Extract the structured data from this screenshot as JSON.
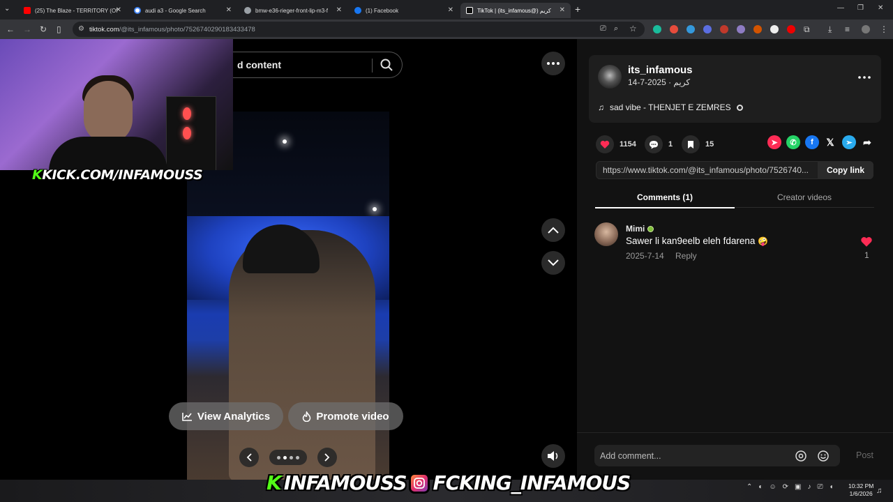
{
  "browser": {
    "tabs": [
      {
        "label": "(25) The Blaze - TERRITORY (Of",
        "color": "#ff0000"
      },
      {
        "label": "audi a3 - Google Search",
        "color": "#4285f4"
      },
      {
        "label": "bmw-e36-rieger-front-lip-m3-f",
        "color": "#9aa0a6"
      },
      {
        "label": "(1) Facebook",
        "color": "#1877f2"
      },
      {
        "label": "TikTok | (its_infamous@) كريم",
        "color": "#ffffff"
      }
    ],
    "new_tab": "+",
    "url_host": "tiktok.com",
    "url_path": "/@its_infamous/photo/7526740290183433478"
  },
  "stream": {
    "kick_channel": "KICK.COM/INFAMOUSS",
    "kick_k": "K",
    "overlay_kick": "INFAMOUSS",
    "overlay_instagram": "FCKING_INFAMOUS"
  },
  "viewer": {
    "search_text": "d content",
    "view_analytics": "View Analytics",
    "promote_video": "Promote video"
  },
  "post": {
    "username": "its_infamous",
    "display_name": "كريم",
    "date": "2025-7-14",
    "music": "sad vibe - THENJET E ZEMRES",
    "likes": "1154",
    "comments": "1",
    "saves": "15",
    "link": "https://www.tiktok.com/@its_infamous/photo/7526740...",
    "copy_link": "Copy link"
  },
  "tabs": {
    "comments": "Comments (1)",
    "creator_videos": "Creator videos"
  },
  "comment": {
    "name": "Mimi",
    "text": "Sawer li kan9eelb eleh fdarena",
    "emoji": "🤪",
    "date": "2025-7-14",
    "reply": "Reply",
    "likes": "1"
  },
  "composer": {
    "placeholder": "Add comment...",
    "post": "Post"
  },
  "taskbar": {
    "time": "10:32 PM",
    "date": "1/6/2026"
  },
  "colors": {
    "like": "#fe2c55",
    "kick_green": "#53fc18",
    "whatsapp": "#25d366",
    "facebook": "#1877f2",
    "telegram": "#2aabee"
  }
}
